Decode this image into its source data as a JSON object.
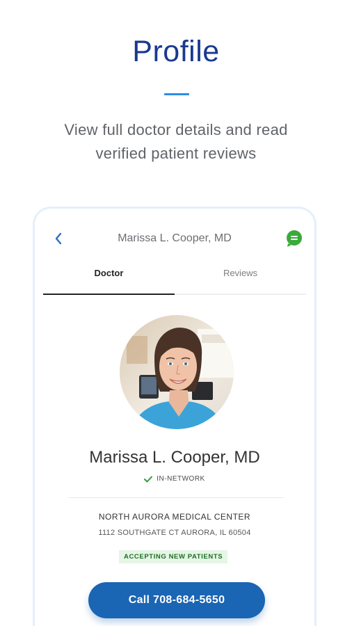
{
  "promo": {
    "title": "Profile",
    "subtitle_line1": "View full doctor details and read",
    "subtitle_line2": "verified patient reviews"
  },
  "header": {
    "title": "Marissa L. Cooper, MD",
    "back_icon": "chevron-left-icon",
    "chat_icon": "chat-icon"
  },
  "tabs": [
    {
      "label": "Doctor",
      "active": true
    },
    {
      "label": "Reviews",
      "active": false
    }
  ],
  "doctor": {
    "name": "Marissa L. Cooper, MD",
    "network_status": "IN-NETWORK",
    "facility_name": "NORTH AURORA MEDICAL CENTER",
    "address": "1112 SOUTHGATE CT AURORA, IL 60504",
    "badge": "ACCEPTING NEW PATIENTS"
  },
  "actions": {
    "call_label": "Call 708-684-5650"
  },
  "colors": {
    "title_blue": "#1a3a8f",
    "accent_blue": "#2b8de3",
    "call_button": "#1a65b4",
    "chat_green": "#3aaa3a",
    "check_green": "#2e9b3a",
    "badge_bg": "#e6f5e6",
    "badge_text": "#1d6f23"
  }
}
